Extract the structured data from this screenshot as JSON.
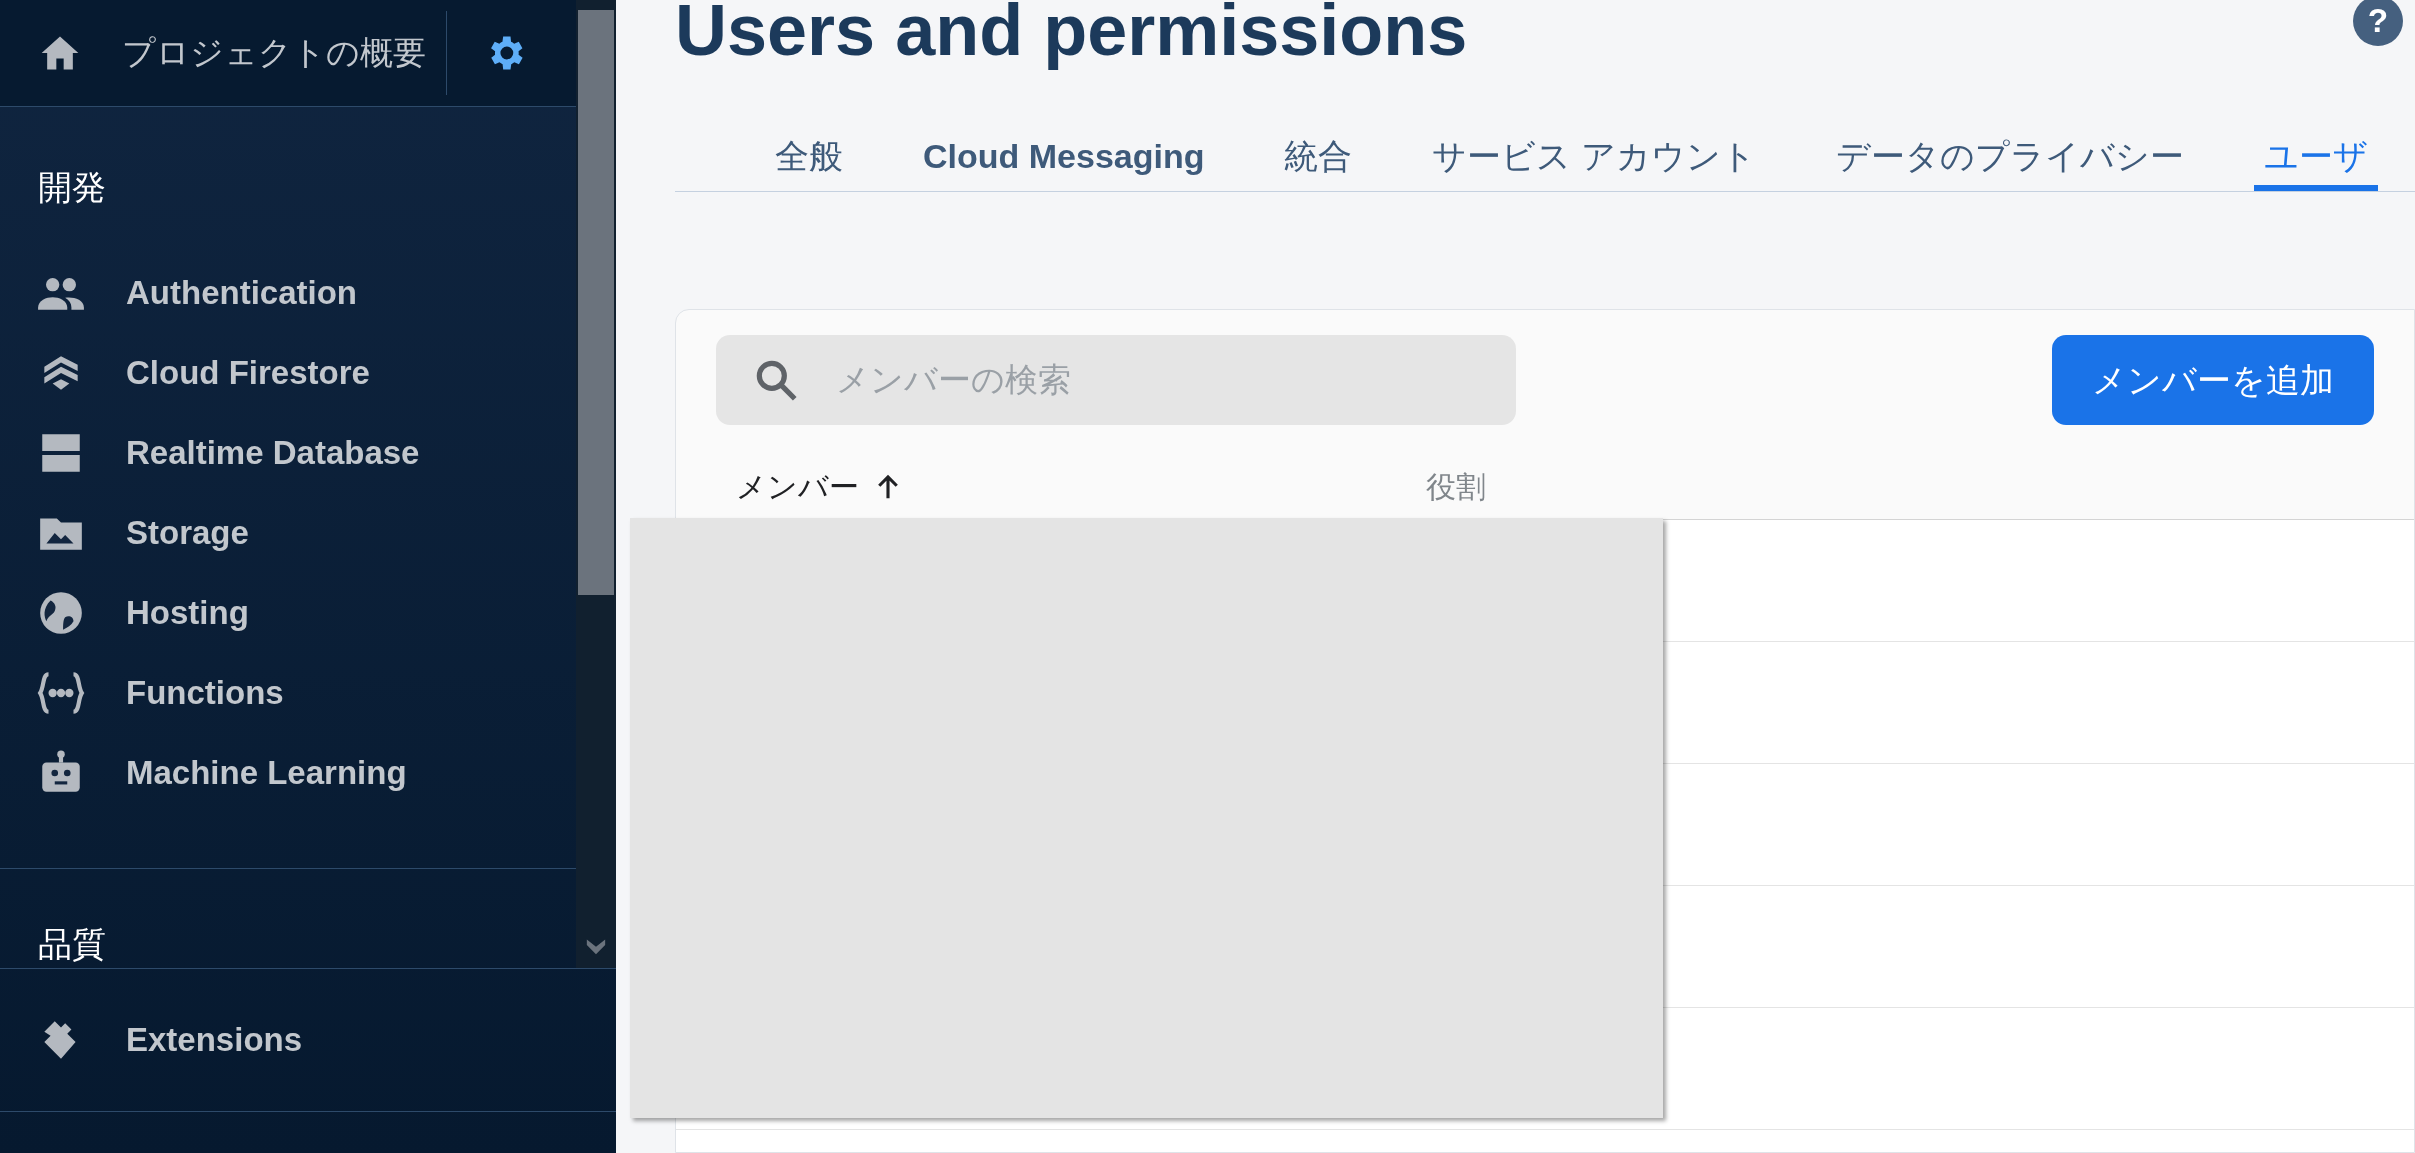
{
  "sidebar": {
    "project_overview": "プロジェクトの概要",
    "sections": [
      {
        "title": "開発",
        "items": [
          {
            "label": "Authentication",
            "kind": "users"
          },
          {
            "label": "Cloud Firestore",
            "kind": "firestore"
          },
          {
            "label": "Realtime Database",
            "kind": "database"
          },
          {
            "label": "Storage",
            "kind": "storage"
          },
          {
            "label": "Hosting",
            "kind": "globe"
          },
          {
            "label": "Functions",
            "kind": "functions"
          },
          {
            "label": "Machine Learning",
            "kind": "robot"
          }
        ]
      },
      {
        "title": "品質"
      }
    ],
    "extensions": "Extensions"
  },
  "page": {
    "title": "Users and permissions",
    "help": "?",
    "tabs": [
      {
        "label": "全般",
        "selected": false
      },
      {
        "label": "Cloud Messaging",
        "selected": false
      },
      {
        "label": "統合",
        "selected": false
      },
      {
        "label": "サービス アカウント",
        "selected": false
      },
      {
        "label": "データのプライバシー",
        "selected": false
      },
      {
        "label": "ユーザ",
        "selected": true
      }
    ],
    "search": {
      "placeholder": "メンバーの検索"
    },
    "add_button": "メンバーを追加",
    "table": {
      "columns": [
        {
          "label": "メンバー",
          "sorted": true
        },
        {
          "label": "役割",
          "sorted": false
        }
      ]
    }
  }
}
